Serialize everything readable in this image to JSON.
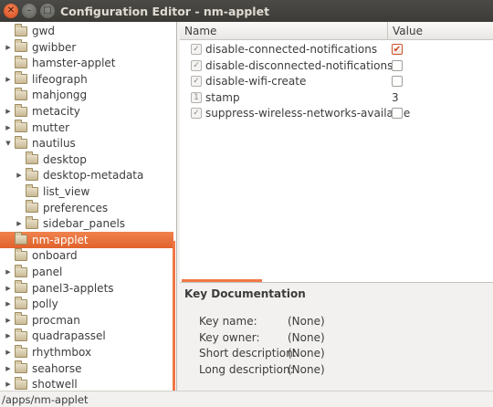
{
  "window": {
    "title": "Configuration Editor - nm-applet",
    "controls": [
      "close-icon",
      "minimize-icon",
      "maximize-icon"
    ]
  },
  "tree": {
    "items": [
      {
        "label": "gwd",
        "expandable": false,
        "selected": false,
        "indent": 1
      },
      {
        "label": "gwibber",
        "expandable": true,
        "selected": false,
        "indent": 1
      },
      {
        "label": "hamster-applet",
        "expandable": false,
        "selected": false,
        "indent": 1
      },
      {
        "label": "lifeograph",
        "expandable": true,
        "selected": false,
        "indent": 1
      },
      {
        "label": "mahjongg",
        "expandable": false,
        "selected": false,
        "indent": 1
      },
      {
        "label": "metacity",
        "expandable": true,
        "selected": false,
        "indent": 1
      },
      {
        "label": "mutter",
        "expandable": true,
        "selected": false,
        "indent": 1
      },
      {
        "label": "nautilus",
        "expandable": true,
        "expanded": true,
        "selected": false,
        "indent": 1
      },
      {
        "label": "desktop",
        "expandable": false,
        "selected": false,
        "indent": 2
      },
      {
        "label": "desktop-metadata",
        "expandable": true,
        "selected": false,
        "indent": 2
      },
      {
        "label": "list_view",
        "expandable": false,
        "selected": false,
        "indent": 2
      },
      {
        "label": "preferences",
        "expandable": false,
        "selected": false,
        "indent": 2
      },
      {
        "label": "sidebar_panels",
        "expandable": true,
        "selected": false,
        "indent": 2
      },
      {
        "label": "nm-applet",
        "expandable": false,
        "selected": true,
        "indent": 1
      },
      {
        "label": "onboard",
        "expandable": false,
        "selected": false,
        "indent": 1
      },
      {
        "label": "panel",
        "expandable": true,
        "selected": false,
        "indent": 1
      },
      {
        "label": "panel3-applets",
        "expandable": true,
        "selected": false,
        "indent": 1
      },
      {
        "label": "polly",
        "expandable": true,
        "selected": false,
        "indent": 1
      },
      {
        "label": "procman",
        "expandable": true,
        "selected": false,
        "indent": 1
      },
      {
        "label": "quadrapassel",
        "expandable": true,
        "selected": false,
        "indent": 1
      },
      {
        "label": "rhythmbox",
        "expandable": true,
        "selected": false,
        "indent": 1
      },
      {
        "label": "seahorse",
        "expandable": true,
        "selected": false,
        "indent": 1
      },
      {
        "label": "shotwell",
        "expandable": true,
        "selected": false,
        "indent": 1
      }
    ]
  },
  "keys": {
    "header_name": "Name",
    "header_value": "Value",
    "rows": [
      {
        "name": "disable-connected-notifications",
        "type": "bool",
        "value": true,
        "value_text": ""
      },
      {
        "name": "disable-disconnected-notifications",
        "type": "bool",
        "value": false,
        "value_text": ""
      },
      {
        "name": "disable-wifi-create",
        "type": "bool",
        "value": false,
        "value_text": ""
      },
      {
        "name": "stamp",
        "type": "int",
        "value": 3,
        "value_text": "3"
      },
      {
        "name": "suppress-wireless-networks-available",
        "type": "bool",
        "value": false,
        "value_text": ""
      }
    ]
  },
  "documentation": {
    "title": "Key Documentation",
    "fields": [
      {
        "label": "Key name:",
        "value": "(None)"
      },
      {
        "label": "Key owner:",
        "value": "(None)"
      },
      {
        "label": "Short description:",
        "value": "(None)"
      },
      {
        "label": "Long description:",
        "value": "(None)"
      }
    ]
  },
  "statusbar": {
    "path": "/apps/nm-applet"
  },
  "colors": {
    "accent": "#e9662f",
    "titlebar": "#3c3b37"
  }
}
